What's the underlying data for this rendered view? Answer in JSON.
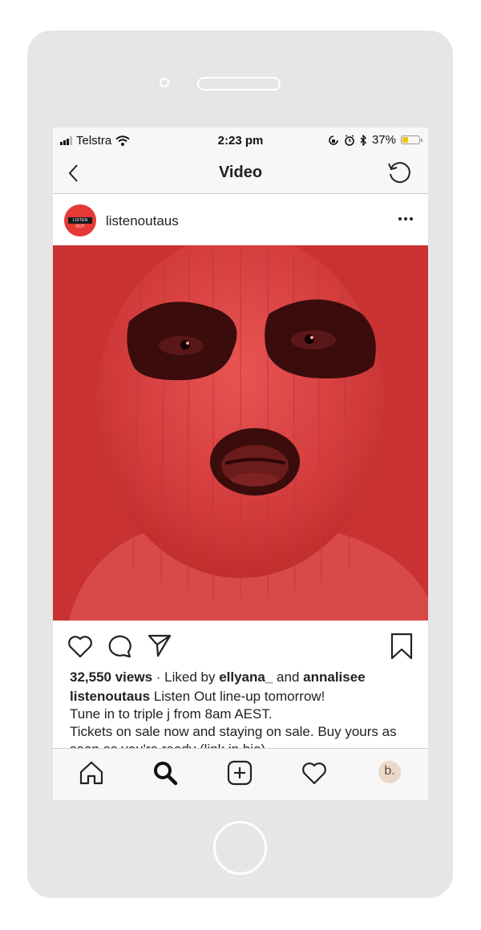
{
  "status_bar": {
    "carrier": "Telstra",
    "time": "2:23 pm",
    "battery_percent": "37%",
    "battery_level": 0.37,
    "icons": [
      "signal-icon",
      "wifi-icon",
      "orientation-lock-icon",
      "alarm-icon",
      "bluetooth-icon",
      "battery-icon"
    ]
  },
  "nav": {
    "title": "Video",
    "back_icon": "chevron-left-icon",
    "refresh_icon": "refresh-icon"
  },
  "post": {
    "username": "listenoutaus",
    "avatar_logo_text": "LISTEN OUT",
    "more_icon": "ellipsis-icon",
    "media_accent": "#c93333",
    "views": "32,550 views",
    "liked_by_text": "· Liked by",
    "liker_1": "ellyana_",
    "and_text": "and",
    "liker_2": "annalisee",
    "caption_user": "listenoutaus",
    "caption_line_1": "Listen Out line-up tomorrow!",
    "caption_line_2": "Tune in to triple j from 8am AEST.",
    "caption_line_3": "Tickets on sale now and staying on sale. Buy yours as",
    "caption_line_4": "soon as you're ready (link in bio)"
  },
  "actions": {
    "icons": [
      "heart-icon",
      "comment-icon",
      "share-icon",
      "bookmark-icon"
    ]
  },
  "tab_bar": {
    "icons": [
      "home-icon",
      "search-icon",
      "add-icon",
      "activity-icon"
    ],
    "profile_initial": "b."
  }
}
